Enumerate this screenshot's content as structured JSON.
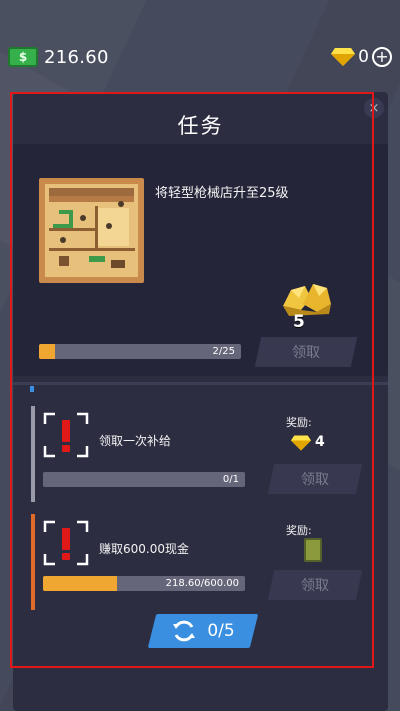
{
  "hud": {
    "cash_icon": "cash-icon",
    "cash_icon_text": "$",
    "cash_value": "216.60",
    "gem_icon": "gem-icon",
    "gem_value": "0",
    "plus_label": "+"
  },
  "panel": {
    "title": "任务",
    "close_label": "×"
  },
  "main_task": {
    "description": "将轻型枪械店升至25级",
    "reward_icon": "gold-nugget-icon",
    "reward_count": "5",
    "progress": {
      "current": 2,
      "target": 25,
      "fraction": 0.08,
      "text": "2/25"
    },
    "claim_label": "领取"
  },
  "tasks": [
    {
      "description": "领取一次补给",
      "reward_label": "奖励:",
      "reward_icon": "gem-icon",
      "reward_value": "4",
      "progress": {
        "fraction": 0.0,
        "text": "0/1"
      },
      "claim_label": "领取",
      "stripe_color": "#9a9aa8"
    },
    {
      "description": "赚取600.00现金",
      "reward_label": "奖励:",
      "reward_icon": "card-icon",
      "progress": {
        "fraction": 0.364,
        "text": "218.60/600.00"
      },
      "claim_label": "领取",
      "stripe_color": "#e06a2a"
    }
  ],
  "refresh": {
    "icon": "refresh-icon",
    "count_text": "0/5"
  },
  "colors": {
    "progress_fill": "#f0a732",
    "accent_blue": "#3a8fe0",
    "alert_red": "#e01818"
  }
}
